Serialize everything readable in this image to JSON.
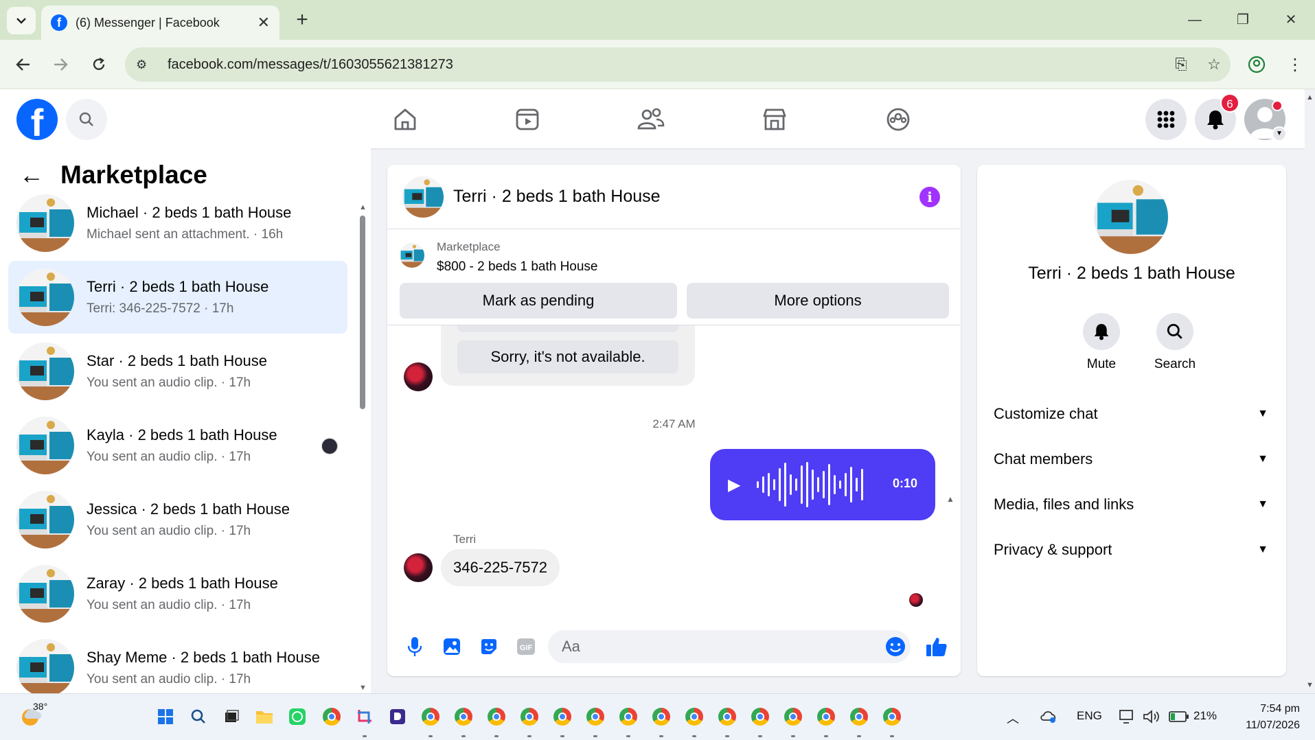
{
  "browser": {
    "tab_title": "(6) Messenger | Facebook",
    "url": "facebook.com/messages/t/1603055621381273"
  },
  "fb_header": {
    "notification_count": "6"
  },
  "sidebar": {
    "title": "Marketplace",
    "conversations": [
      {
        "name": "Michael · 2 beds 1 bath House",
        "snippet": "Michael sent an attachment. · 16h",
        "active": false
      },
      {
        "name": "Terri · 2 beds 1 bath House",
        "snippet": "Terri: 346-225-7572 · 17h",
        "active": true
      },
      {
        "name": "Star · 2 beds 1 bath House",
        "snippet": "You sent an audio clip. · 17h",
        "active": false
      },
      {
        "name": "Kayla · 2 beds 1 bath House",
        "snippet": "You sent an audio clip. · 17h",
        "active": false
      },
      {
        "name": "Jessica · 2 beds 1 bath House",
        "snippet": "You sent an audio clip. · 17h",
        "active": false
      },
      {
        "name": "Zaray · 2 beds 1 bath House",
        "snippet": "You sent an audio clip. · 17h",
        "active": false
      },
      {
        "name": "Shay Meme · 2 beds 1 bath House",
        "snippet": "You sent an audio clip. · 17h",
        "active": false
      }
    ]
  },
  "chat": {
    "title": "Terri · 2 beds 1 bath House",
    "listing": {
      "source": "Marketplace",
      "price_title": "$800 - 2 beds 1 bath House",
      "mark_pending_label": "Mark as pending",
      "more_options_label": "More options"
    },
    "quick_reply": "Sorry, it's not available.",
    "timestamp": "2:47 AM",
    "audio_duration": "0:10",
    "sender_name": "Terri",
    "last_message": "346-225-7572",
    "composer_placeholder": "Aa"
  },
  "info_panel": {
    "name": "Terri · 2 beds 1 bath House",
    "mute_label": "Mute",
    "search_label": "Search",
    "sections": [
      "Customize chat",
      "Chat members",
      "Media, files and links",
      "Privacy & support"
    ]
  },
  "taskbar": {
    "temperature": "38°",
    "language": "ENG",
    "battery": "21%",
    "time": "7:54 pm",
    "date": "11/07/2026"
  },
  "colors": {
    "fb_blue": "#0866ff",
    "audio_bubble": "#4f3cf5",
    "info_icon": "#a033ff",
    "active_conversation": "#e6f0ff",
    "notification_badge": "#e41e3f"
  }
}
